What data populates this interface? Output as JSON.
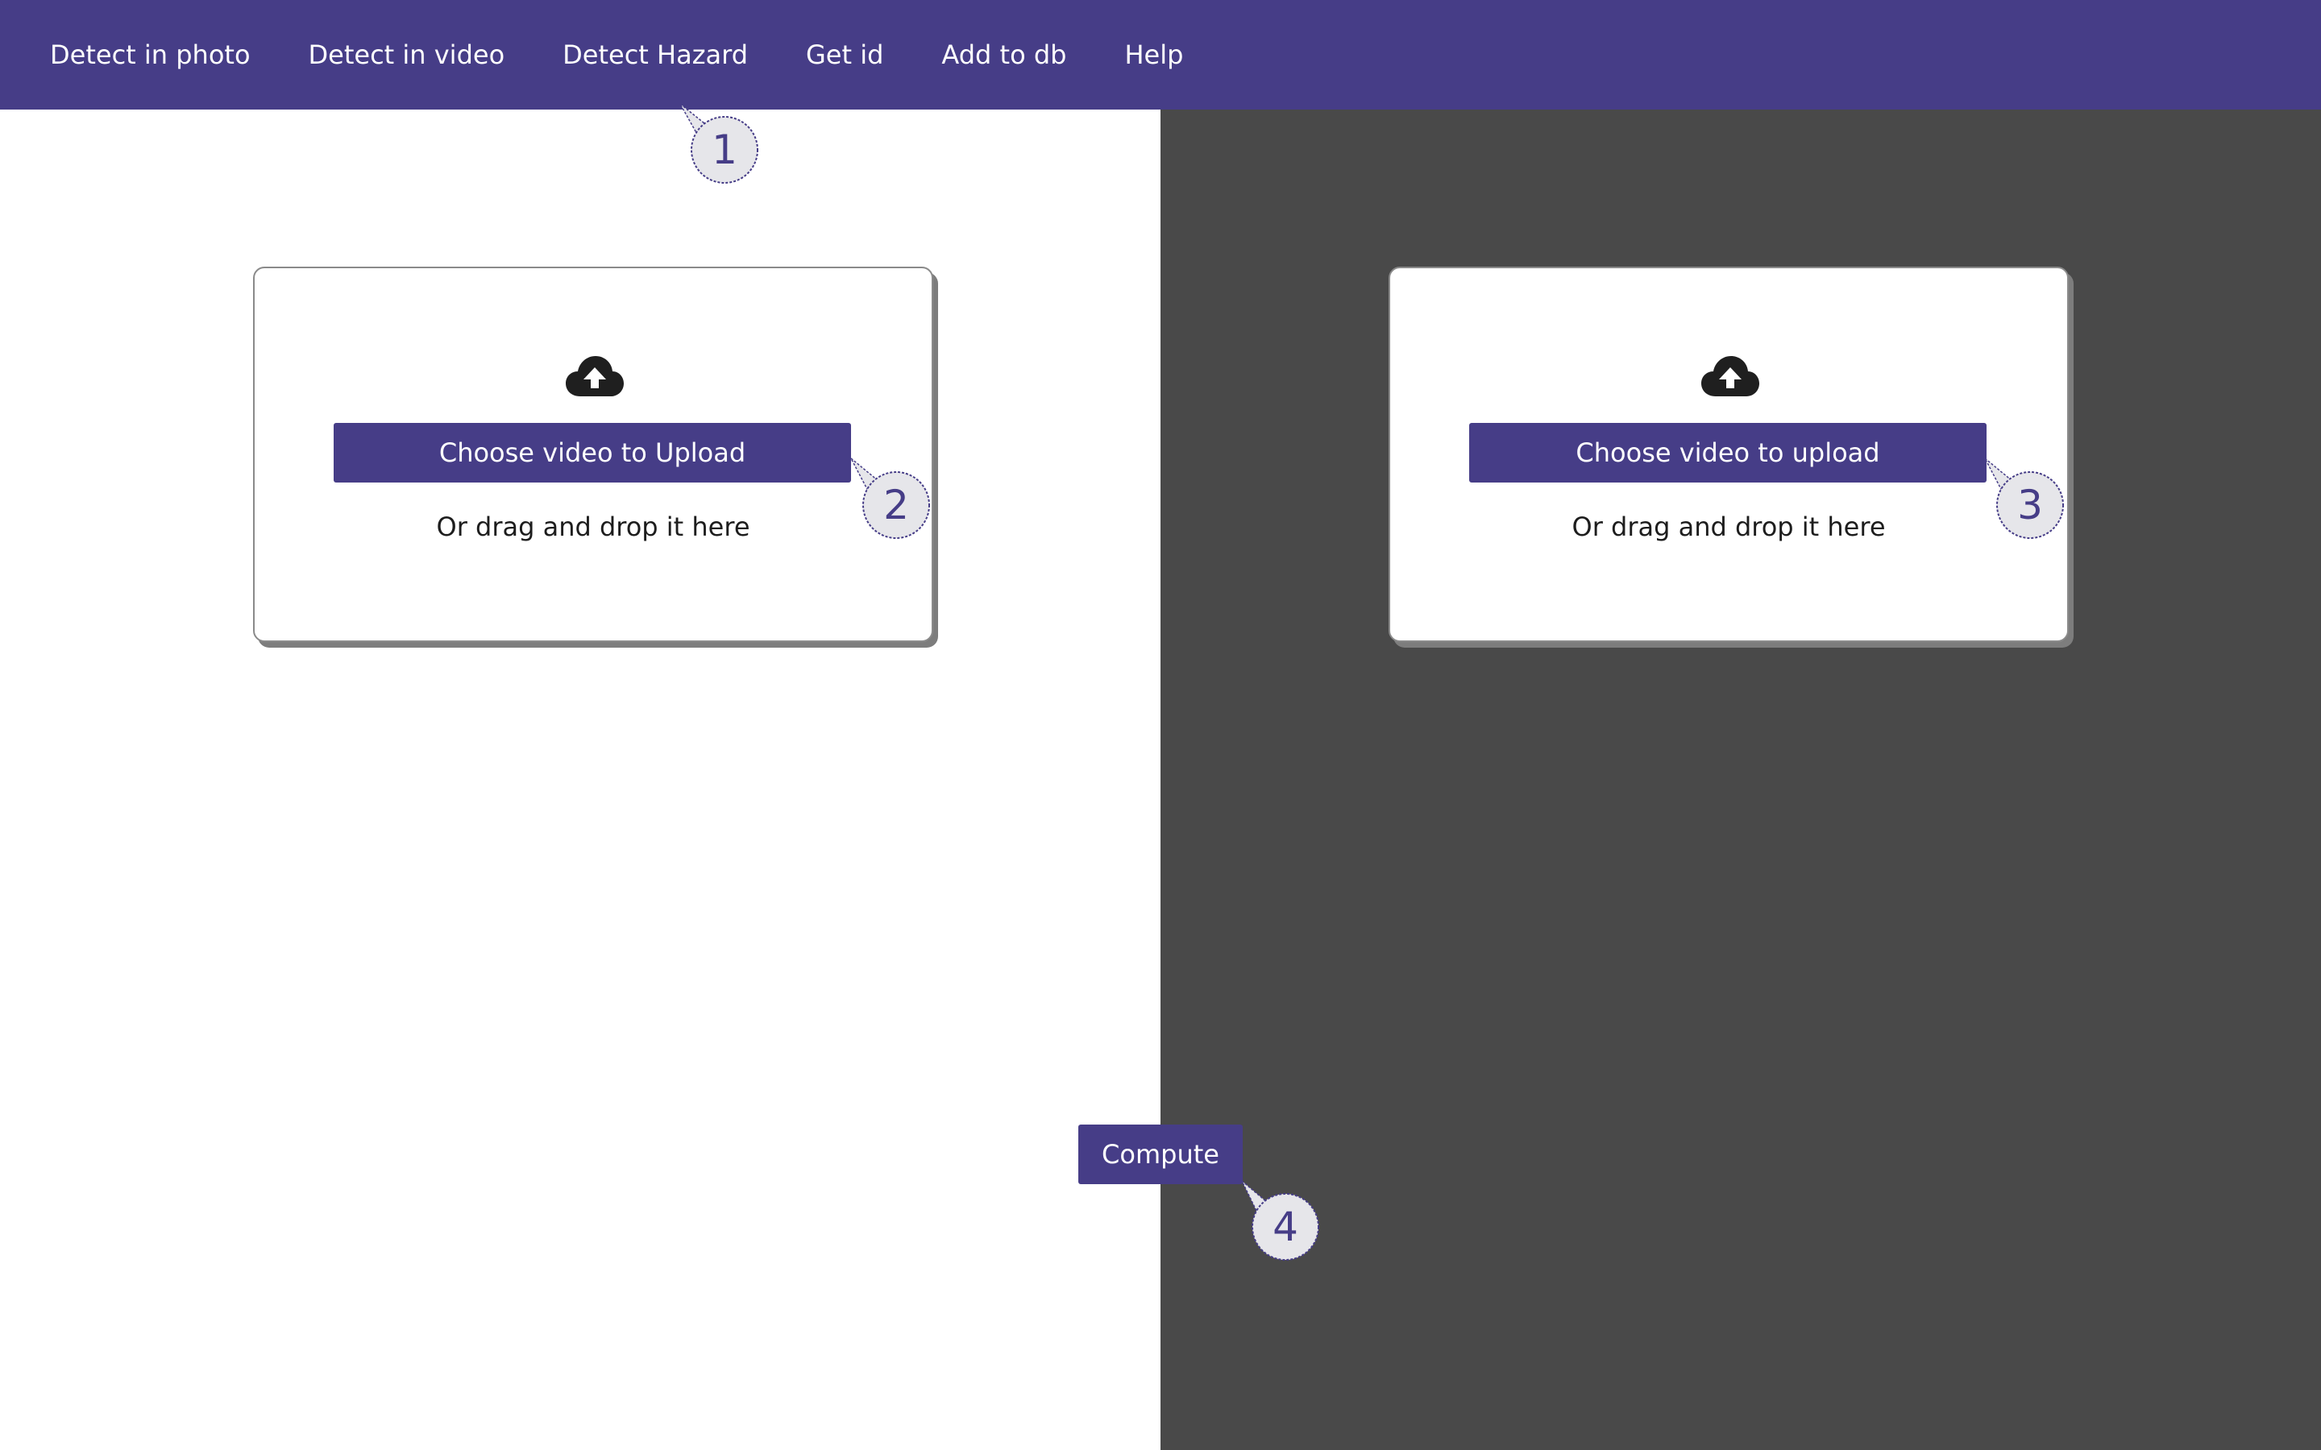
{
  "nav": {
    "items": [
      {
        "label": "Detect in photo"
      },
      {
        "label": "Detect in video"
      },
      {
        "label": "Detect Hazard"
      },
      {
        "label": "Get id"
      },
      {
        "label": "Add to db"
      },
      {
        "label": "Help"
      }
    ]
  },
  "left_upload": {
    "icon": "cloud-upload-icon",
    "button_label": "Choose video to Upload",
    "drag_text": "Or drag and drop it here"
  },
  "right_upload": {
    "icon": "cloud-upload-icon",
    "button_label": "Choose video to upload",
    "drag_text": "Or drag and drop it here"
  },
  "compute": {
    "label": "Compute"
  },
  "callouts": [
    "1",
    "2",
    "3",
    "4"
  ],
  "colors": {
    "accent": "#463d87",
    "dark_pane": "#494949",
    "callout_fill": "#e6e6ea"
  }
}
